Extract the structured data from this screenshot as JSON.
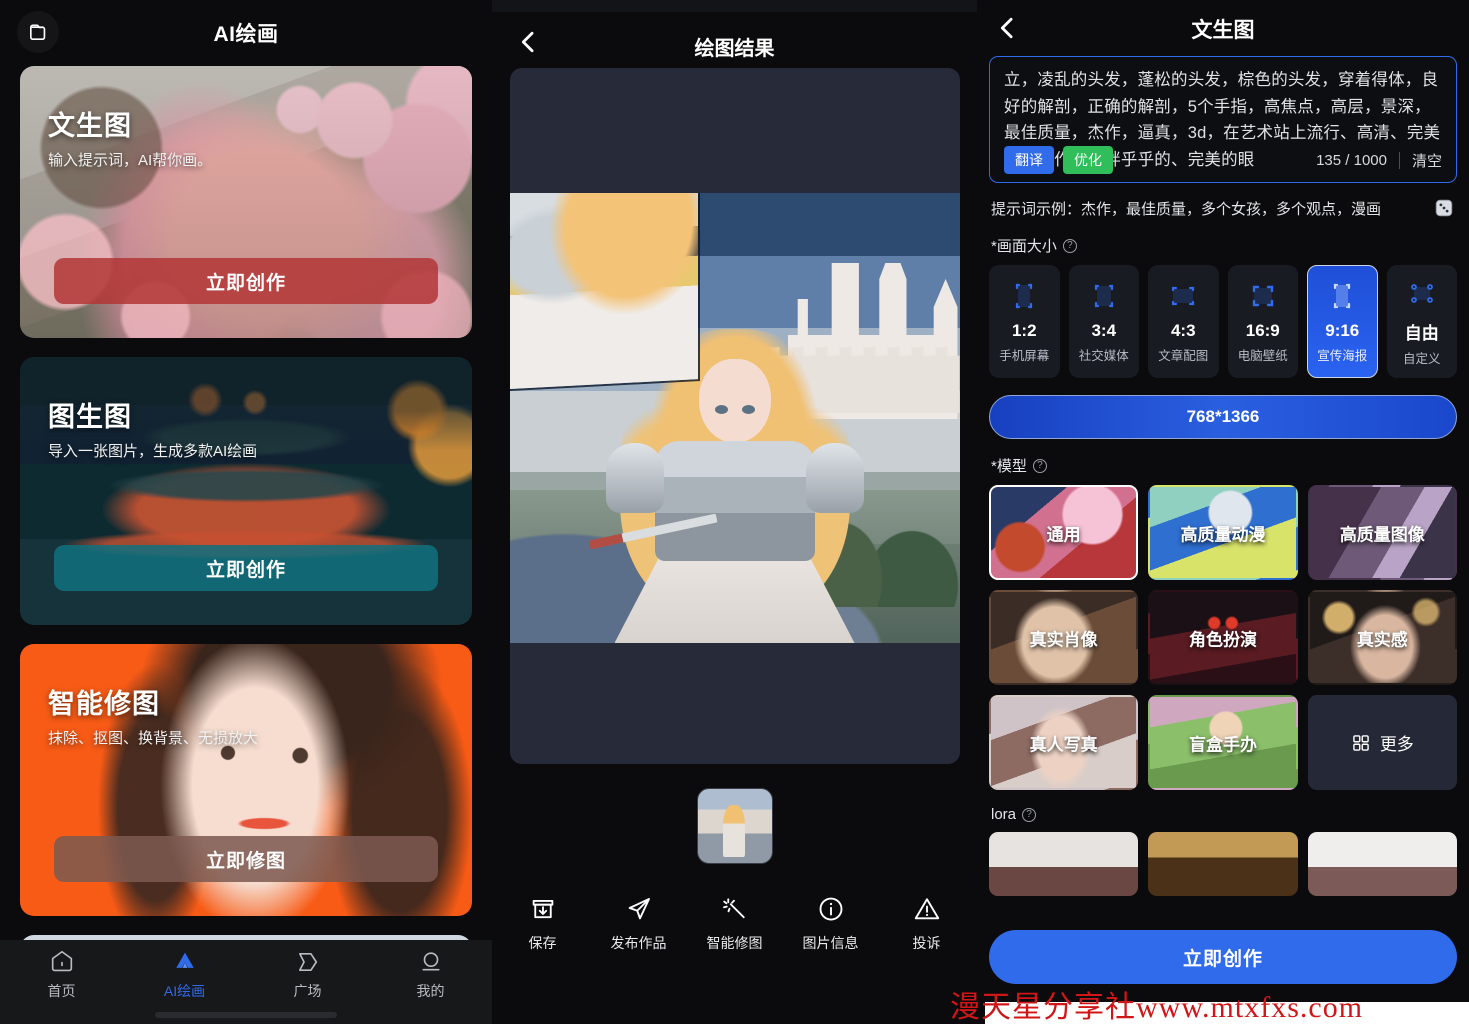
{
  "app": {
    "watermark": "漫天星分享社www.mtxfxs.com"
  },
  "panel_home": {
    "title": "AI绘画",
    "folder_icon": "folder-icon",
    "cards": [
      {
        "title": "文生图",
        "subtitle": "输入提示词，AI帮你画。",
        "button": "立即创作",
        "accent": "#b23434"
      },
      {
        "title": "图生图",
        "subtitle": "导入一张图片，生成多款AI绘画",
        "button": "立即创作",
        "accent": "#11707e"
      },
      {
        "title": "智能修图",
        "subtitle": "抹除、抠图、换背景、无损放大",
        "button": "立即修图",
        "accent": "#7d5a50"
      }
    ],
    "tabs": [
      {
        "label": "首页",
        "icon": "home-icon",
        "active": false
      },
      {
        "label": "AI绘画",
        "icon": "ai-paint-icon",
        "active": true
      },
      {
        "label": "广场",
        "icon": "plaza-icon",
        "active": false
      },
      {
        "label": "我的",
        "icon": "profile-icon",
        "active": false
      }
    ],
    "active_tab_color": "#2f6bea"
  },
  "panel_result": {
    "title": "绘图结果",
    "back_icon": "back-chevron-icon",
    "thumbnail_alt": "generated-image-thumbnail",
    "actions": [
      {
        "label": "保存",
        "icon": "save-download-icon"
      },
      {
        "label": "发布作品",
        "icon": "publish-send-icon"
      },
      {
        "label": "智能修图",
        "icon": "magic-wand-icon"
      },
      {
        "label": "图片信息",
        "icon": "info-circle-icon"
      },
      {
        "label": "投诉",
        "icon": "warning-triangle-icon"
      }
    ]
  },
  "panel_create": {
    "title": "文生图",
    "back_icon": "back-chevron-icon",
    "prompt": {
      "text": "立，凌乱的头发，蓬松的头发，棕色的头发，穿着得体，良好的解剖，正确的解剖，5个手指，高焦点，高层，景深，最佳质量，杰作，逼真，3d，在艺术站上流行、高清、完美的艺术作品、胖乎乎的、完美的眼",
      "translate_label": "翻译",
      "optimize_label": "优化",
      "counter": "135 / 1000",
      "clear_label": "清空"
    },
    "example": {
      "label": "提示词示例：杰作，最佳质量，多个女孩，多个观点，漫画",
      "dice_icon": "dice-icon"
    },
    "size_section": {
      "label": "*画面大小",
      "help_icon": "question-mark-icon",
      "options": [
        {
          "ratio": "1:2",
          "name": "手机屏幕",
          "selected": false
        },
        {
          "ratio": "3:4",
          "name": "社交媒体",
          "selected": false
        },
        {
          "ratio": "4:3",
          "name": "文章配图",
          "selected": false
        },
        {
          "ratio": "16:9",
          "name": "电脑壁纸",
          "selected": false
        },
        {
          "ratio": "9:16",
          "name": "宣传海报",
          "selected": true
        },
        {
          "ratio": "自由",
          "name": "自定义",
          "selected": false
        }
      ],
      "resolution": "768*1366"
    },
    "model_section": {
      "label": "*模型",
      "help_icon": "question-mark-icon",
      "models": [
        {
          "name": "通用",
          "selected": true
        },
        {
          "name": "高质量动漫",
          "selected": false
        },
        {
          "name": "高质量图像",
          "selected": false
        },
        {
          "name": "真实肖像",
          "selected": false
        },
        {
          "name": "角色扮演",
          "selected": false
        },
        {
          "name": "真实感",
          "selected": false
        },
        {
          "name": "真人写真",
          "selected": false
        },
        {
          "name": "盲盒手办",
          "selected": false
        }
      ],
      "more_label": "更多",
      "more_icon": "grid-icon"
    },
    "lora_section": {
      "label": "lora",
      "help_icon": "question-mark-icon"
    },
    "create_button": "立即创作",
    "accent_color": "#2f6bea"
  }
}
